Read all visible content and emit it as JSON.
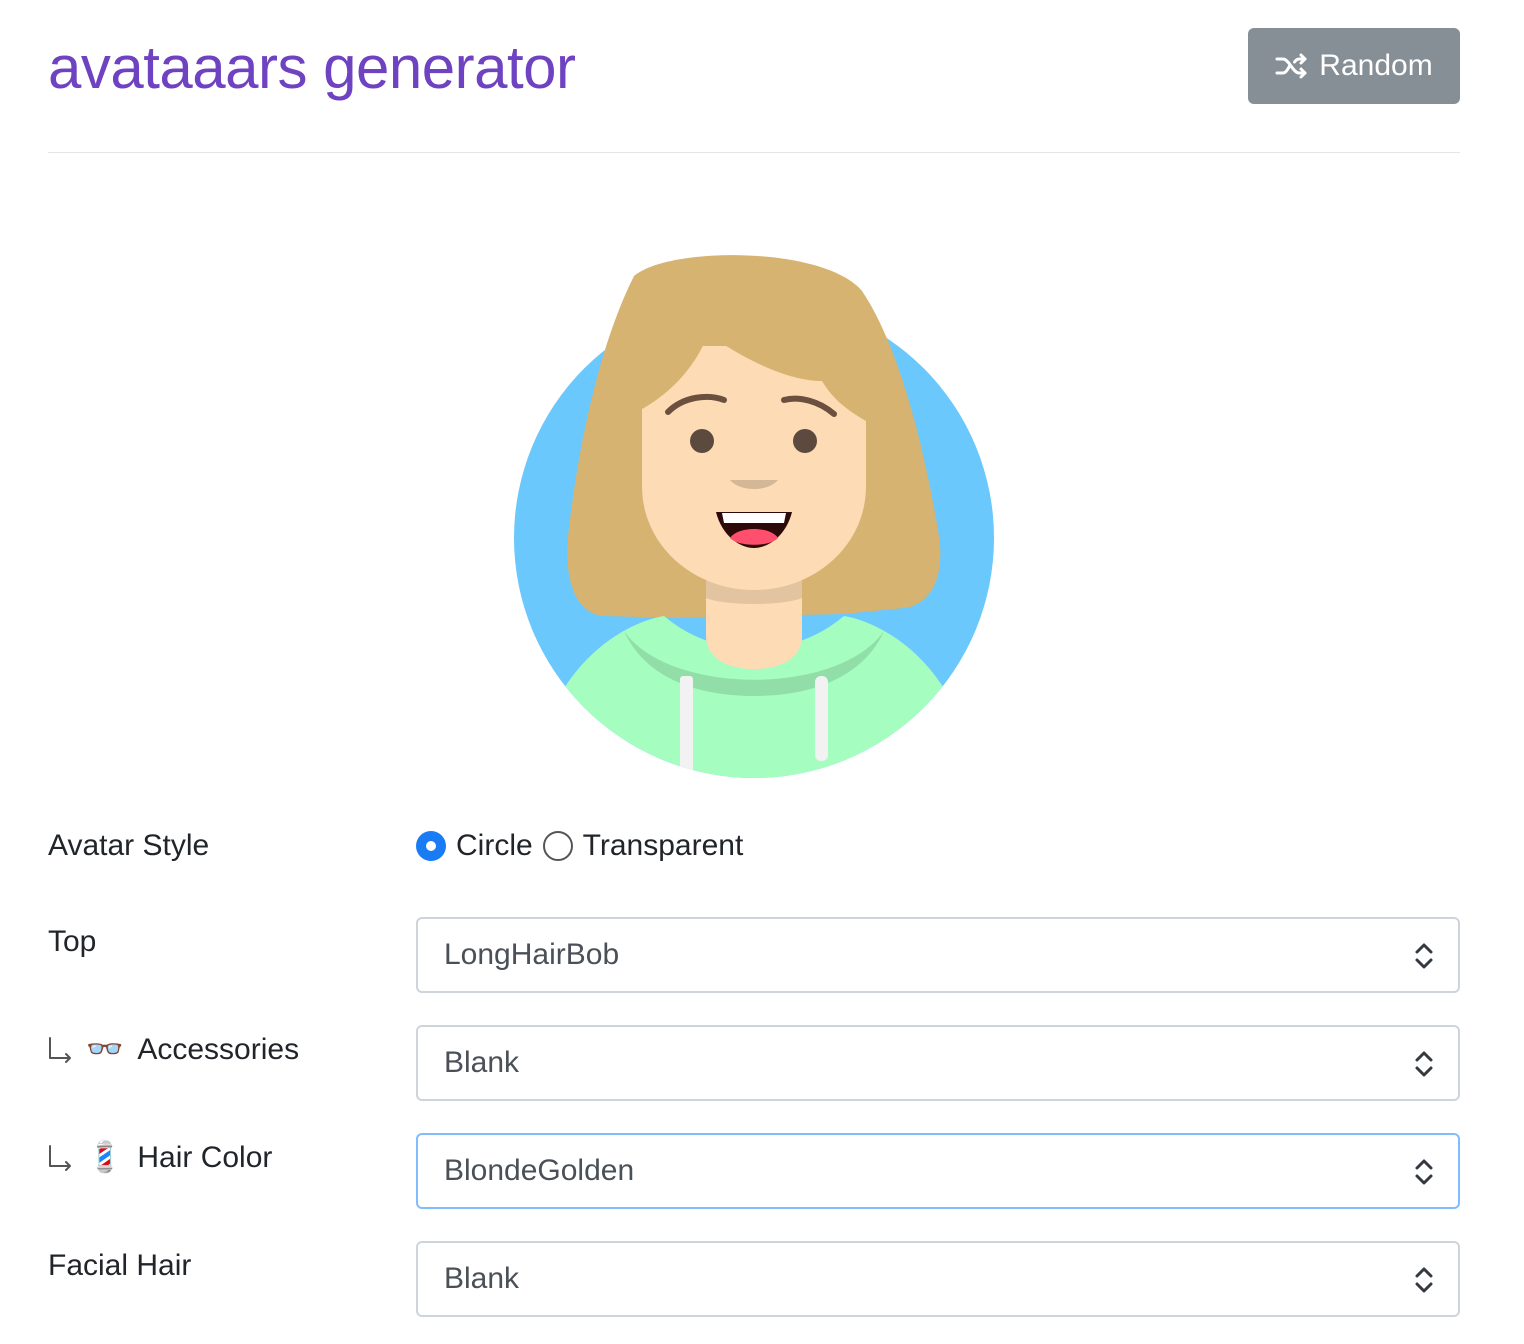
{
  "header": {
    "title": "avataaars generator",
    "random_label": "Random"
  },
  "colors": {
    "title": "#6f42c1",
    "button": "#868e96",
    "avatar_background": "#6ac8fc",
    "hair": "#d6b370",
    "skin": "#fddbb4",
    "clothes": "#a6fdc0"
  },
  "form": {
    "avatar_style": {
      "label": "Avatar Style",
      "options": [
        "Circle",
        "Transparent"
      ],
      "selected": "Circle"
    },
    "top": {
      "label": "Top",
      "value": "LongHairBob"
    },
    "accessories": {
      "label": "Accessories",
      "icon": "glasses-icon",
      "emoji": "👓",
      "value": "Blank"
    },
    "hair_color": {
      "label": "Hair Color",
      "icon": "barber-pole-icon",
      "emoji": "💈",
      "value": "BlondeGolden"
    },
    "facial_hair": {
      "label": "Facial Hair",
      "value": "Blank"
    }
  }
}
